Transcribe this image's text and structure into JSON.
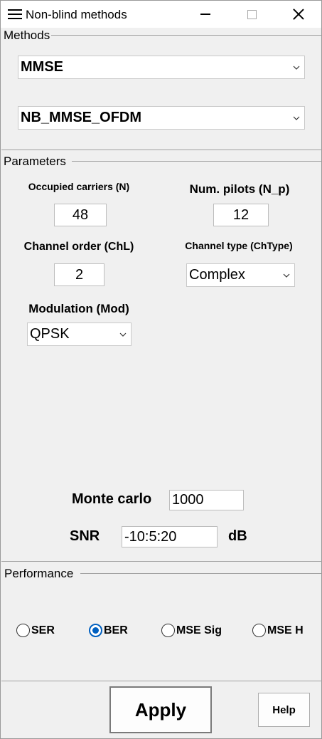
{
  "window": {
    "title": "Non-blind methods",
    "icons": {
      "menu": "hamburger-menu-icon",
      "minimize": "minimize-icon",
      "maximize": "maximize-icon",
      "close": "close-icon"
    }
  },
  "methods_panel": {
    "title": "Methods",
    "method_select": "MMSE",
    "algorithm_select": "NB_MMSE_OFDM"
  },
  "parameters_panel": {
    "title": "Parameters",
    "occupied_carriers": {
      "label": "Occupied carriers (N)",
      "value": "48"
    },
    "num_pilots": {
      "label": "Num. pilots (N_p)",
      "value": "12"
    },
    "channel_order": {
      "label": "Channel order (ChL)",
      "value": "2"
    },
    "channel_type": {
      "label": "Channel type (ChType)",
      "value": "Complex"
    },
    "modulation": {
      "label": "Modulation (Mod)",
      "value": "QPSK"
    },
    "monte_carlo": {
      "label": "Monte carlo",
      "value": "1000"
    },
    "snr": {
      "label": "SNR",
      "value": "-10:5:20",
      "unit": "dB"
    }
  },
  "performance_panel": {
    "title": "Performance",
    "options": [
      {
        "label": "SER",
        "checked": false
      },
      {
        "label": "BER",
        "checked": true
      },
      {
        "label": "MSE Sig",
        "checked": false
      },
      {
        "label": "MSE H",
        "checked": false
      }
    ]
  },
  "buttons": {
    "apply": "Apply",
    "help": "Help"
  },
  "colors": {
    "accent": "#0060c0",
    "background": "#f0f0f0",
    "titlebar": "#ffffff"
  }
}
